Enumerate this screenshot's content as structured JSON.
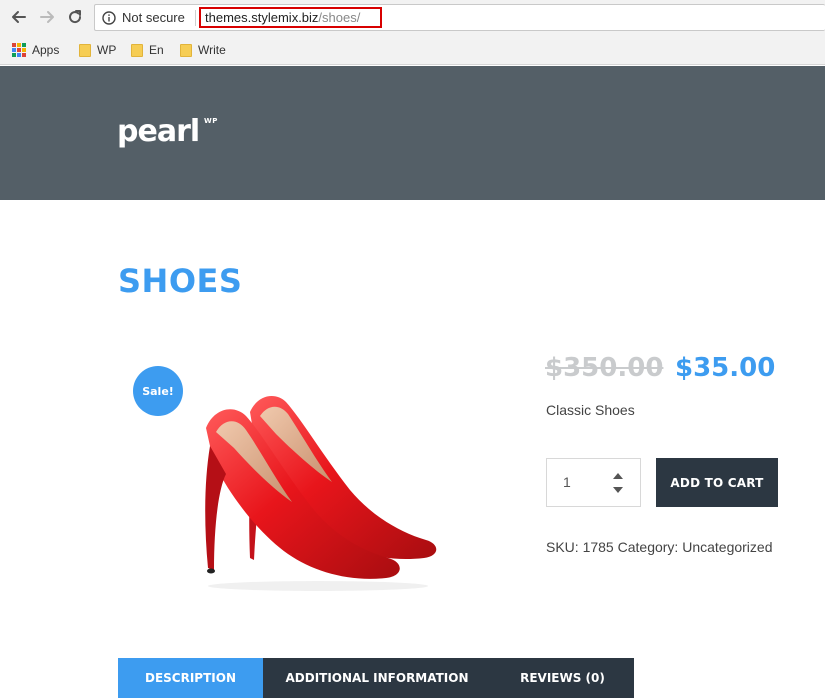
{
  "browser": {
    "security_label": "Not secure",
    "url_host": "themes.stylemix.biz",
    "url_path": "/shoes/",
    "bookmarks": [
      {
        "label": "Apps",
        "icon": "apps-grid-icon"
      },
      {
        "label": "WP",
        "icon": "folder-icon"
      },
      {
        "label": "En",
        "icon": "folder-icon"
      },
      {
        "label": "Write",
        "icon": "folder-icon"
      }
    ]
  },
  "header": {
    "logo_text": "pearl",
    "logo_sup": "WP"
  },
  "page": {
    "title": "SHOES"
  },
  "product": {
    "sale_badge": "Sale!",
    "price_old": "$350.00",
    "price_new": "$35.00",
    "short_description": "Classic Shoes",
    "quantity": "1",
    "add_to_cart_label": "ADD TO CART",
    "sku_label": "SKU:",
    "sku": "1785",
    "category_label": "Category:",
    "category": "Uncategorized",
    "image_alt": "red-stiletto-heels"
  },
  "tabs": [
    {
      "label": "DESCRIPTION",
      "active": true
    },
    {
      "label": "ADDITIONAL INFORMATION",
      "active": false
    },
    {
      "label": "REVIEWS (0)",
      "active": false
    }
  ],
  "colors": {
    "accent": "#3d9cf0",
    "header_bg": "#545f67",
    "dark": "#2c3742",
    "sale_old_price": "#c9cbcd",
    "product_red": "#e8151b"
  }
}
